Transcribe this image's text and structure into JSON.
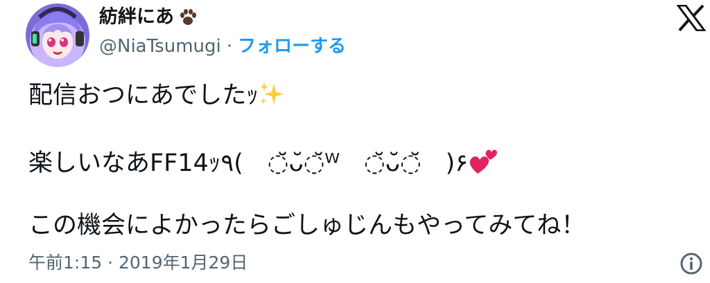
{
  "author": {
    "display_name": "紡絆にあ",
    "handle": "@NiaTsumugi",
    "separator": "·",
    "follow_label": "フォローする"
  },
  "tweet": {
    "line1": "配信おつにあでしたｯ",
    "line2": "楽しいなあFF14ｯ٩(　◌̆ᴗ̆◌̆ᵂ　◌̆ᴗ̆◌̆　)۶",
    "line3": "この機会によかったらごしゅじんもやってみてね！"
  },
  "meta": {
    "timestamp": "午前1:15 · 2019年1月29日"
  },
  "icons": {
    "paw": "paw-icon",
    "x_logo": "x-logo-icon",
    "sparkles": "sparkles-icon",
    "hearts": "two-hearts-icon",
    "info": "info-icon"
  },
  "colors": {
    "follow": "#1d9bf0",
    "secondary_text": "#536471",
    "heart": "#e0245e",
    "sparkle": "#ffcc33"
  }
}
